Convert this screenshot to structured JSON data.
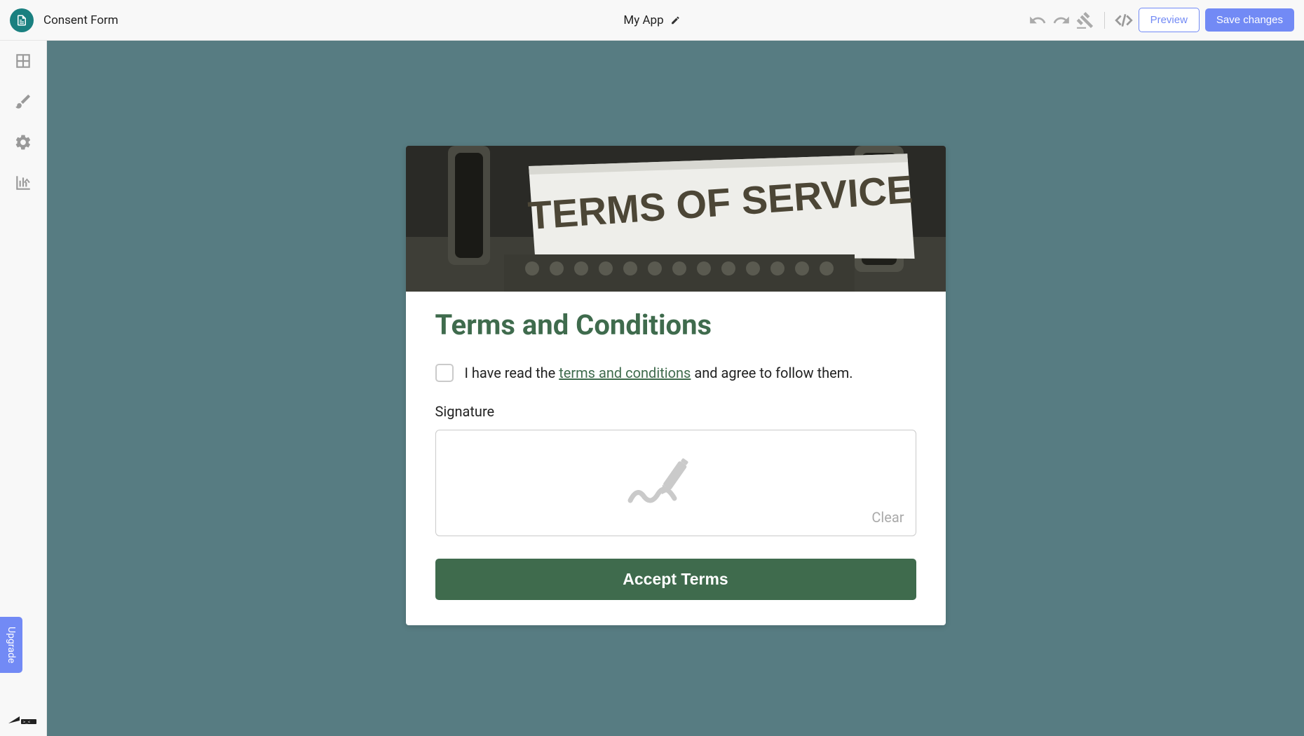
{
  "topbar": {
    "page_name": "Consent Form",
    "app_name": "My App",
    "preview_label": "Preview",
    "save_label": "Save changes"
  },
  "sidebar": {
    "upgrade_label": "Upgrade"
  },
  "form": {
    "hero_text": "TERMS OF SERVICE",
    "title": "Terms and Conditions",
    "checkbox_label_prefix": "I have read the ",
    "checkbox_link": "terms and conditions",
    "checkbox_label_suffix": " and agree to follow them.",
    "signature_label": "Signature",
    "clear_label": "Clear",
    "accept_label": "Accept Terms"
  }
}
